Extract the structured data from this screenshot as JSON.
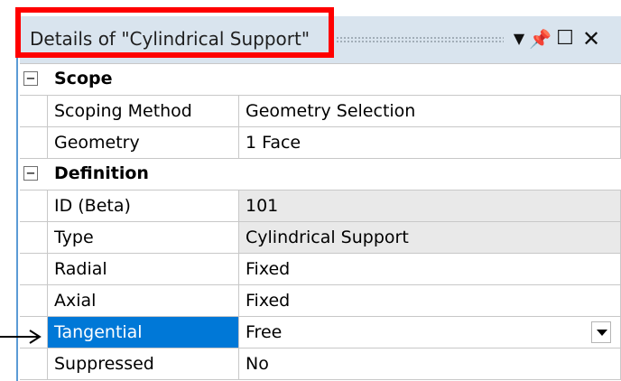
{
  "window": {
    "title": "Details of \"Cylindrical Support\"",
    "controls": {
      "dropdown_icon": "dropdown-arrow",
      "pin_icon": "pin",
      "maximize_icon": "maximize",
      "close_icon": "close"
    },
    "highlight_color": "#ff0000"
  },
  "sections": [
    {
      "title": "Scope",
      "expanded": true,
      "rows": [
        {
          "name": "Scoping Method",
          "value": "Geometry Selection"
        },
        {
          "name": "Geometry",
          "value": "1 Face"
        }
      ]
    },
    {
      "title": "Definition",
      "expanded": true,
      "rows": [
        {
          "name": "ID (Beta)",
          "value": "101",
          "readonly": true
        },
        {
          "name": "Type",
          "value": "Cylindrical Support",
          "readonly": true
        },
        {
          "name": "Radial",
          "value": "Fixed"
        },
        {
          "name": "Axial",
          "value": "Fixed"
        },
        {
          "name": "Tangential",
          "value": "Free",
          "selected": true,
          "has_dropdown": true
        },
        {
          "name": "Suppressed",
          "value": "No"
        }
      ]
    }
  ],
  "annotations": {
    "pointer_arrow_target": "Tangential"
  },
  "colors": {
    "selection": "#0078d7",
    "readonly_bg": "#e9e9e9",
    "titlebar_bg": "#d9e4ee",
    "accent_rule": "#5b9bd5"
  }
}
